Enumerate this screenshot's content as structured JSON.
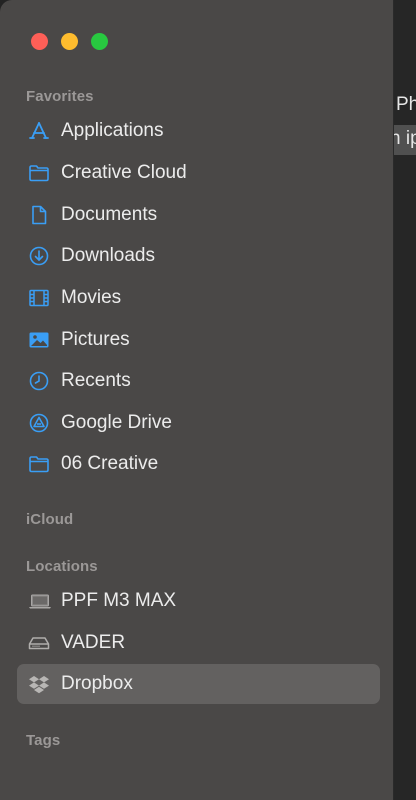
{
  "window": {
    "content_text_1": "Ph",
    "content_text_2": "n ip"
  },
  "sidebar": {
    "favorites": {
      "header": "Favorites",
      "items": [
        {
          "label": "Applications",
          "icon": "applications-icon"
        },
        {
          "label": "Creative Cloud",
          "icon": "folder-icon"
        },
        {
          "label": "Documents",
          "icon": "document-icon"
        },
        {
          "label": "Downloads",
          "icon": "downloads-icon"
        },
        {
          "label": "Movies",
          "icon": "film-icon"
        },
        {
          "label": "Pictures",
          "icon": "photo-icon"
        },
        {
          "label": "Recents",
          "icon": "clock-icon"
        },
        {
          "label": "Google Drive",
          "icon": "google-drive-icon"
        },
        {
          "label": "06 Creative",
          "icon": "folder-icon"
        }
      ]
    },
    "icloud": {
      "header": "iCloud"
    },
    "locations": {
      "header": "Locations",
      "items": [
        {
          "label": "PPF M3 MAX",
          "icon": "laptop-icon",
          "selected": false
        },
        {
          "label": "VADER",
          "icon": "drive-icon",
          "selected": false
        },
        {
          "label": "Dropbox",
          "icon": "dropbox-icon",
          "selected": true
        }
      ]
    },
    "tags": {
      "header": "Tags"
    }
  },
  "colors": {
    "accent": "#3a9ef5",
    "sidebar_bg": "#4a4847",
    "selected_bg": "#636160",
    "text": "#ececec",
    "header_text": "#9b9897"
  }
}
